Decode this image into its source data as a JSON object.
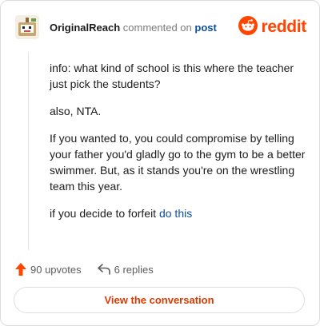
{
  "header": {
    "author": "OriginalReach",
    "action": "commented on",
    "post_link": "post",
    "brand": "reddit"
  },
  "comment": {
    "p1": "info: what kind of school is this where the teacher just pick the students?",
    "p2": "also, NTA.",
    "p3": "If you wanted to, you could compromise by telling your father you'd gladly go to the gym to be a better swimmer. But, as it stands you're on the wrestling team this year.",
    "p4_prefix": "if you decide to forfeit ",
    "p4_link": "do this"
  },
  "stats": {
    "upvotes": "90 upvotes",
    "replies": "6 replies"
  },
  "cta": "View the conversation",
  "colors": {
    "brand": "#ff4500",
    "link": "#0b4f9c",
    "cta_text": "#d93a00"
  },
  "icons": [
    "avatar",
    "reddit-logo-icon",
    "upvote-arrow-icon",
    "reply-icon"
  ]
}
